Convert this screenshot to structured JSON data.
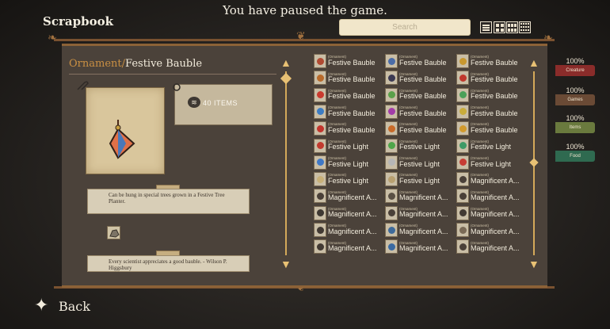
{
  "header": {
    "pause_text": "You have paused the game.",
    "title": "Scrapbook",
    "search_placeholder": "Search"
  },
  "view_modes": [
    "list-view",
    "two-column-view",
    "three-column-view",
    "four-column-view"
  ],
  "detail": {
    "category": "Ornament",
    "separator": "/",
    "name": "Festive Bauble",
    "items_count": "40 ITEMS",
    "description": "Can be hung in special trees grown in a Festive Tree Planter.",
    "quote": "Every scientist appreciates a good bauble. - Wilson P. Higgsbury"
  },
  "grid": {
    "rows": [
      [
        {
          "cat": "(Ornament)",
          "name": "Festive Bauble",
          "icon": "#b04a32"
        },
        {
          "cat": "(Ornament)",
          "name": "Festive Bauble",
          "icon": "#4a6ca8"
        },
        {
          "cat": "(Ornament)",
          "name": "Festive Bauble",
          "icon": "#c8982f"
        }
      ],
      [
        {
          "cat": "(Ornament)",
          "name": "Festive Bauble",
          "icon": "#b86a2a"
        },
        {
          "cat": "(Ornament)",
          "name": "Festive Bauble",
          "icon": "#3c3a52"
        },
        {
          "cat": "(Ornament)",
          "name": "Festive Bauble",
          "icon": "#c0382c"
        }
      ],
      [
        {
          "cat": "(Ornament)",
          "name": "Festive Bauble",
          "icon": "#c93a2e"
        },
        {
          "cat": "(Ornament)",
          "name": "Festive Bauble",
          "icon": "#5aa04a"
        },
        {
          "cat": "(Ornament)",
          "name": "Festive Bauble",
          "icon": "#4aa058"
        }
      ],
      [
        {
          "cat": "(Ornament)",
          "name": "Festive Bauble",
          "icon": "#3c7cc2"
        },
        {
          "cat": "(Ornament)",
          "name": "Festive Bauble",
          "icon": "#a23ca8"
        },
        {
          "cat": "(Ornament)",
          "name": "Festive Bauble",
          "icon": "#c9ac3a"
        }
      ],
      [
        {
          "cat": "(Ornament)",
          "name": "Festive Bauble",
          "icon": "#c2352c"
        },
        {
          "cat": "(Ornament)",
          "name": "Festive Bauble",
          "icon": "#c86a28"
        },
        {
          "cat": "(Ornament)",
          "name": "Festive Bauble",
          "icon": "#d29a2c"
        }
      ],
      [
        {
          "cat": "(Ornament)",
          "name": "Festive Light",
          "icon": "#c23a2e"
        },
        {
          "cat": "(Ornament)",
          "name": "Festive Light",
          "icon": "#4fa64a"
        },
        {
          "cat": "(Ornament)",
          "name": "Festive Light",
          "icon": "#3e9a66"
        }
      ],
      [
        {
          "cat": "(Ornament)",
          "name": "Festive Light",
          "icon": "#3f78c6"
        },
        {
          "cat": "(Ornament)",
          "name": "Festive Light",
          "icon": "#b6b6b6"
        },
        {
          "cat": "(Ornament)",
          "name": "Festive Light",
          "icon": "#c73c33"
        }
      ],
      [
        {
          "cat": "(Ornament)",
          "name": "Festive Light",
          "icon": "#c8b078"
        },
        {
          "cat": "(Ornament)",
          "name": "Festive Light",
          "icon": "#b8a070"
        },
        {
          "cat": "(Ornament)",
          "name": "Magnificent A...",
          "icon": "#4a4038"
        }
      ],
      [
        {
          "cat": "(Ornament)",
          "name": "Magnificent A...",
          "icon": "#4a4038"
        },
        {
          "cat": "(Ornament)",
          "name": "Magnificent A...",
          "icon": "#5a5044"
        },
        {
          "cat": "(Ornament)",
          "name": "Magnificent A...",
          "icon": "#4a4038"
        }
      ],
      [
        {
          "cat": "(Ornament)",
          "name": "Magnificent A...",
          "icon": "#3e3832"
        },
        {
          "cat": "(Ornament)",
          "name": "Magnificent A...",
          "icon": "#4a4038"
        },
        {
          "cat": "(Ornament)",
          "name": "Magnificent A...",
          "icon": "#423a33"
        }
      ],
      [
        {
          "cat": "(Ornament)",
          "name": "Magnificent A...",
          "icon": "#423a33"
        },
        {
          "cat": "(Ornament)",
          "name": "Magnificent A...",
          "icon": "#3e6a9a"
        },
        {
          "cat": "(Ornament)",
          "name": "Magnificent A...",
          "icon": "#7a6a56"
        }
      ],
      [
        {
          "cat": "(Ornament)",
          "name": "Magnificent A...",
          "icon": "#423a33"
        },
        {
          "cat": "(Ornament)",
          "name": "Magnificent A...",
          "icon": "#3a6aa2"
        },
        {
          "cat": "(Ornament)",
          "name": "Magnificent A...",
          "icon": "#4a4038"
        }
      ]
    ]
  },
  "categories": [
    {
      "percent": "100%",
      "label": "Creature",
      "color": "#8a2c2a"
    },
    {
      "percent": "100%",
      "label": "Games",
      "color": "#6a4a35"
    },
    {
      "percent": "100%",
      "label": "Items",
      "color": "#6a7a3e"
    },
    {
      "percent": "100%",
      "label": "Food",
      "color": "#2f6a50"
    }
  ],
  "footer": {
    "back_label": "Back"
  }
}
